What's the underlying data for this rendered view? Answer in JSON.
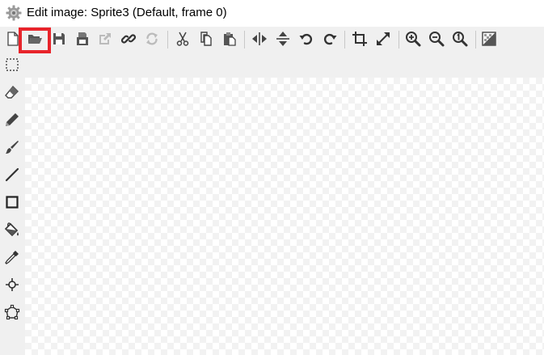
{
  "window": {
    "title": "Edit image: Sprite3 (Default, frame 0)",
    "app_icon": "gear-icon"
  },
  "toolbar": {
    "items": [
      {
        "name": "new-icon",
        "label": "New"
      },
      {
        "name": "open-icon",
        "label": "Open",
        "highlighted": true
      },
      {
        "name": "save-icon",
        "label": "Save"
      },
      {
        "name": "save-as-icon",
        "label": "Save as"
      },
      {
        "name": "export-icon",
        "label": "Export"
      },
      {
        "name": "link-icon",
        "label": "Link"
      },
      {
        "name": "refresh-icon",
        "label": "Refresh"
      },
      {
        "name": "cut-icon",
        "label": "Cut"
      },
      {
        "name": "copy-icon",
        "label": "Copy"
      },
      {
        "name": "paste-icon",
        "label": "Paste"
      },
      {
        "name": "flip-horizontal-icon",
        "label": "Flip horizontal"
      },
      {
        "name": "flip-vertical-icon",
        "label": "Flip vertical"
      },
      {
        "name": "rotate-left-icon",
        "label": "Rotate left"
      },
      {
        "name": "rotate-right-icon",
        "label": "Rotate right"
      },
      {
        "name": "crop-icon",
        "label": "Crop"
      },
      {
        "name": "resize-icon",
        "label": "Resize"
      },
      {
        "name": "zoom-in-icon",
        "label": "Zoom in"
      },
      {
        "name": "zoom-out-icon",
        "label": "Zoom out"
      },
      {
        "name": "zoom-actual-icon",
        "label": "Zoom 1:1"
      },
      {
        "name": "transparency-icon",
        "label": "Transparency"
      }
    ],
    "highlight_color": "#e8242b"
  },
  "tools": [
    {
      "name": "select-rect-icon"
    },
    {
      "name": "eraser-icon"
    },
    {
      "name": "pencil-icon"
    },
    {
      "name": "brush-icon"
    },
    {
      "name": "line-icon"
    },
    {
      "name": "rectangle-icon"
    },
    {
      "name": "fill-bucket-icon"
    },
    {
      "name": "color-picker-icon"
    },
    {
      "name": "origin-icon"
    },
    {
      "name": "polygon-icon"
    }
  ]
}
